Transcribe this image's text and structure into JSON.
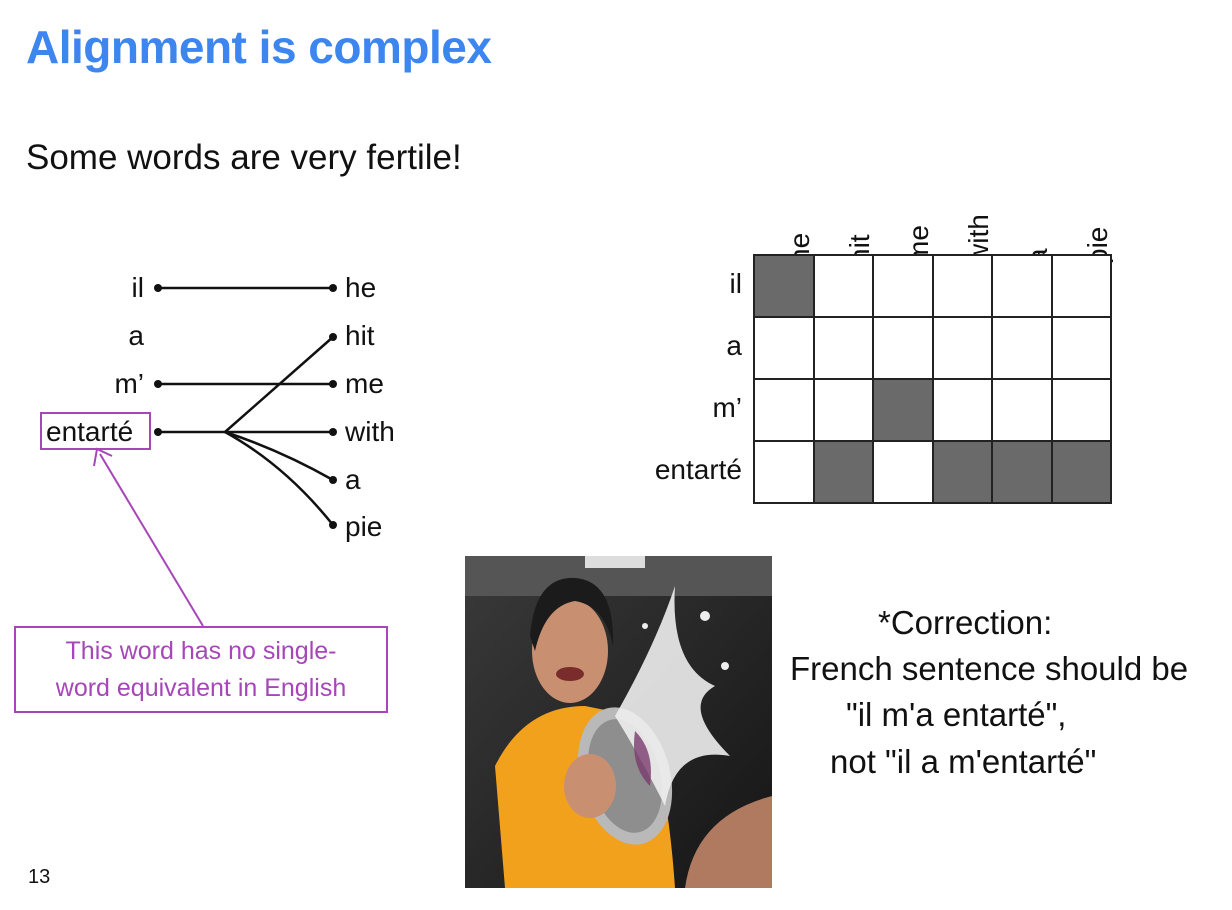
{
  "slide": {
    "title": "Alignment is complex",
    "subtitle": "Some words are very fertile!",
    "page_number": "13"
  },
  "alignment_diagram": {
    "source_words": [
      "il",
      "a",
      "m’",
      "entarté"
    ],
    "target_words": [
      "he",
      "hit",
      "me",
      "with",
      "a",
      "pie"
    ],
    "highlighted_source": "entarté",
    "callout_lines": [
      "This word has no single-",
      "word equivalent in English"
    ],
    "colors": {
      "callout": "#a646b8",
      "title": "#3d86f0"
    }
  },
  "matrix": {
    "col_labels": [
      "he",
      "hit",
      "me",
      "with",
      "a",
      "pie"
    ],
    "row_labels": [
      "il",
      "a",
      "m’",
      "entarté"
    ],
    "cells": [
      [
        1,
        0,
        0,
        0,
        0,
        0
      ],
      [
        0,
        0,
        0,
        0,
        0,
        0
      ],
      [
        0,
        0,
        1,
        0,
        0,
        0
      ],
      [
        0,
        1,
        0,
        1,
        1,
        1
      ]
    ],
    "fill_color": "#6a6a6a"
  },
  "photo": {
    "subject": "person-being-hit-with-pie-photo"
  },
  "correction": {
    "lines": [
      "*Correction:",
      "French sentence should be",
      "\"il m'a entarté\",",
      "not \"il a m'entarté\""
    ]
  }
}
